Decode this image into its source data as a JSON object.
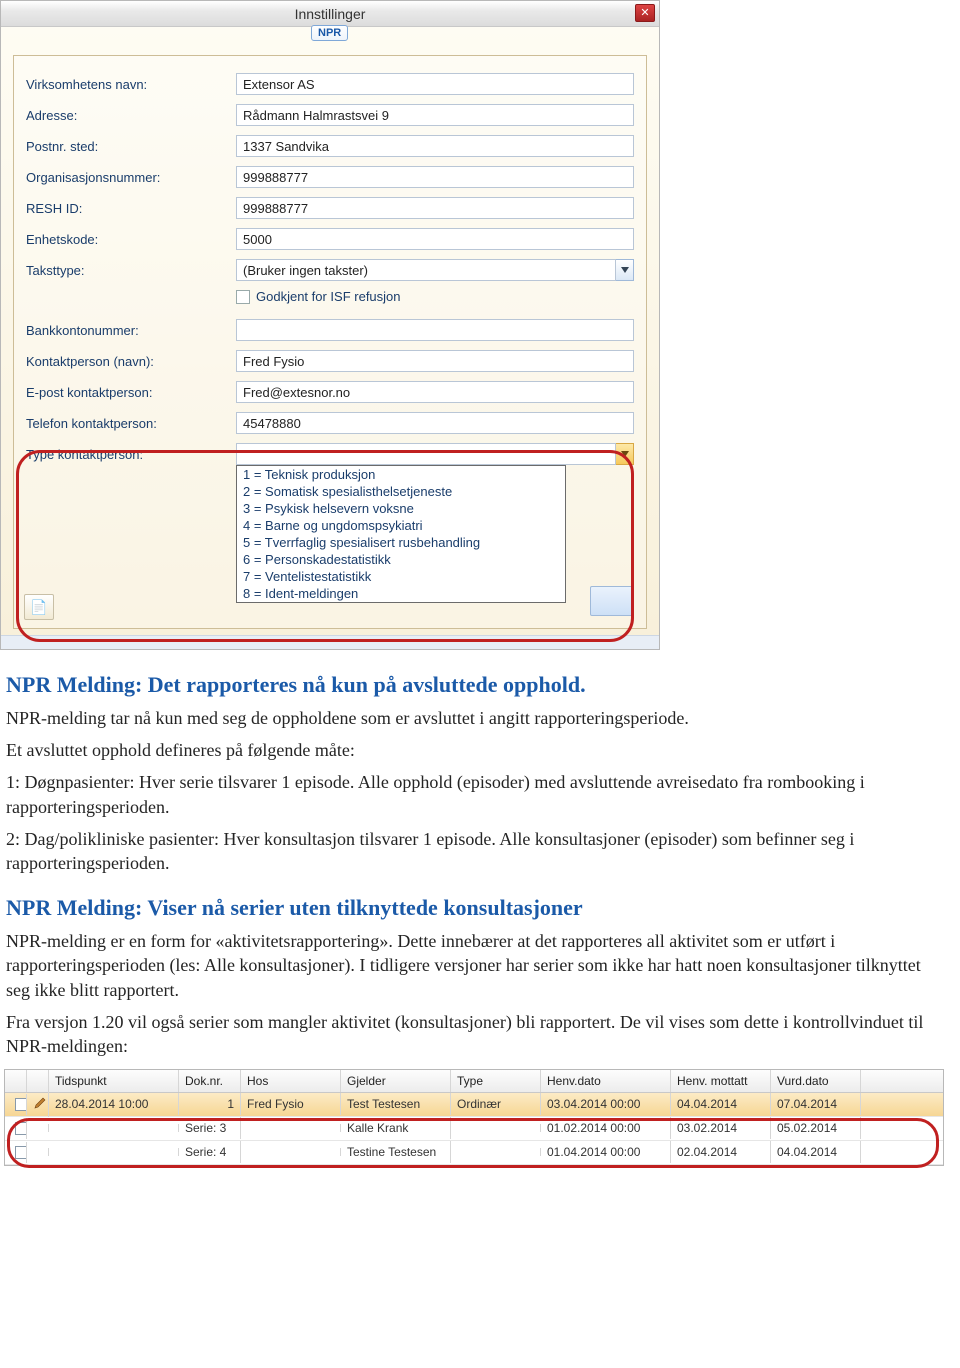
{
  "dialog": {
    "title": "Innstillinger",
    "tab": "NPR",
    "labels": {
      "virksomhet": "Virksomhetens navn:",
      "adresse": "Adresse:",
      "postnr": "Postnr. sted:",
      "orgnr": "Organisasjonsnummer:",
      "resh": "RESH ID:",
      "enhetskode": "Enhetskode:",
      "taksttype": "Taksttype:",
      "godkjent_isf": "Godkjent for ISF refusjon",
      "bankkonto": "Bankkontonummer:",
      "kontaktnavn": "Kontaktperson (navn):",
      "kontaktepost": "E-post kontaktperson:",
      "kontakttlf": "Telefon kontaktperson:",
      "kontakttype": "Type kontaktperson:"
    },
    "values": {
      "virksomhet": "Extensor AS",
      "adresse": "Rådmann Halmrastsvei 9",
      "postnr": "1337 Sandvika",
      "orgnr": "999888777",
      "resh": "999888777",
      "enhetskode": "5000",
      "taksttype": "(Bruker ingen takster)",
      "bankkonto": "",
      "kontaktnavn": "Fred Fysio",
      "kontaktepost": "Fred@extesnor.no",
      "kontakttlf": "45478880",
      "kontakttype": ""
    },
    "kontakttype_options": [
      "1 = Teknisk produksjon",
      "2 = Somatisk spesialisthelsetjeneste",
      "3 = Psykisk helsevern voksne",
      "4 = Barne og ungdomspsykiatri",
      "5 = Tverrfaglig spesialisert rusbehandling",
      "6 = Personskadestatistikk",
      "7 = Ventelistestatistikk",
      "8 = Ident-meldingen"
    ]
  },
  "doc": {
    "h1": "NPR Melding: Det rapporteres nå kun på avsluttede opphold.",
    "p1": "NPR-melding tar nå kun med seg de oppholdene som er avsluttet i angitt rapporteringsperiode.",
    "p2": "Et avsluttet opphold defineres på følgende måte:",
    "p3": "1: Døgnpasienter: Hver serie tilsvarer 1 episode. Alle opphold (episoder) med avsluttende avreisedato fra rombooking i rapporteringsperioden.",
    "p4": "2: Dag/polikliniske pasienter: Hver konsultasjon tilsvarer 1 episode. Alle konsultasjoner (episoder) som befinner seg i rapporteringsperioden.",
    "h2": "NPR Melding: Viser nå serier uten tilknyttede konsultasjoner",
    "p5": "NPR-melding er en form for «aktivitetsrapportering». Dette innebærer at det rapporteres all aktivitet som er utført i rapporteringsperioden (les: Alle konsultasjoner). I tidligere versjoner har serier som ikke har hatt noen konsultasjoner tilknyttet seg ikke blitt rapportert.",
    "p6": "Fra versjon 1.20 vil også serier som mangler aktivitet (konsultasjoner) bli rapportert. De vil vises som dette i kontrollvinduet til NPR-meldingen:"
  },
  "table": {
    "headers": {
      "tidspunkt": "Tidspunkt",
      "doknr": "Dok.nr.",
      "hos": "Hos",
      "gjelder": "Gjelder",
      "type": "Type",
      "henvdato": "Henv.dato",
      "henvmottatt": "Henv. mottatt",
      "vurddato": "Vurd.dato"
    },
    "rows": [
      {
        "selected": true,
        "tidspunkt": "28.04.2014 10:00",
        "doknr": "1",
        "hos": "Fred Fysio",
        "gjelder": "Test Testesen",
        "type": "Ordinær",
        "henvdato": "03.04.2014 00:00",
        "henvmottatt": "04.04.2014",
        "vurddato": "07.04.2014"
      },
      {
        "selected": false,
        "tidspunkt": "",
        "doknr": "Serie: 3",
        "hos": "",
        "gjelder": "Kalle Krank",
        "type": "",
        "henvdato": "01.02.2014 00:00",
        "henvmottatt": "03.02.2014",
        "vurddato": "05.02.2014"
      },
      {
        "selected": false,
        "tidspunkt": "",
        "doknr": "Serie: 4",
        "hos": "",
        "gjelder": "Testine Testesen",
        "type": "",
        "henvdato": "01.04.2014 00:00",
        "henvmottatt": "02.04.2014",
        "vurddato": "04.04.2014"
      }
    ]
  }
}
